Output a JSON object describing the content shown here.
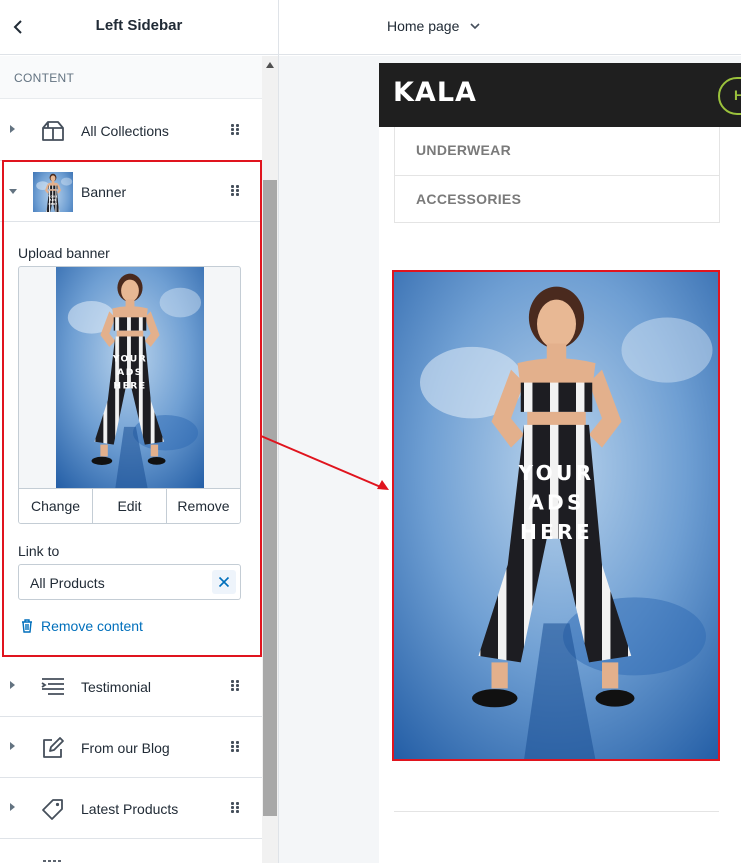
{
  "sidebar": {
    "title": "Left Sidebar",
    "section_label": "CONTENT",
    "items": [
      {
        "label": "All Collections",
        "icon": "collection-icon"
      },
      {
        "label": "Banner",
        "icon": "image-thumbnail"
      },
      {
        "label": "Testimonial",
        "icon": "list-icon"
      },
      {
        "label": "From our Blog",
        "icon": "blog-edit-icon"
      },
      {
        "label": "Latest Products",
        "icon": "tag-icon"
      }
    ],
    "banner_settings": {
      "upload_label": "Upload banner",
      "ad_text": "YOUR ADS HERE",
      "buttons": {
        "change": "Change",
        "edit": "Edit",
        "remove": "Remove"
      },
      "link_label": "Link to",
      "link_value": "All Products",
      "remove_content": "Remove content"
    }
  },
  "topbar": {
    "page_selector": "Home page"
  },
  "store": {
    "logo": "KALA",
    "header_pill": "H",
    "menu_items": [
      "UNDERWEAR",
      "ACCESSORIES"
    ],
    "banner_text_lines": [
      "YOUR",
      "ADS",
      "HERE"
    ]
  },
  "colors": {
    "accent_link": "#006fbb",
    "highlight": "#e0141e",
    "store_header": "#1f1f1f",
    "pill": "#9bc23c"
  }
}
